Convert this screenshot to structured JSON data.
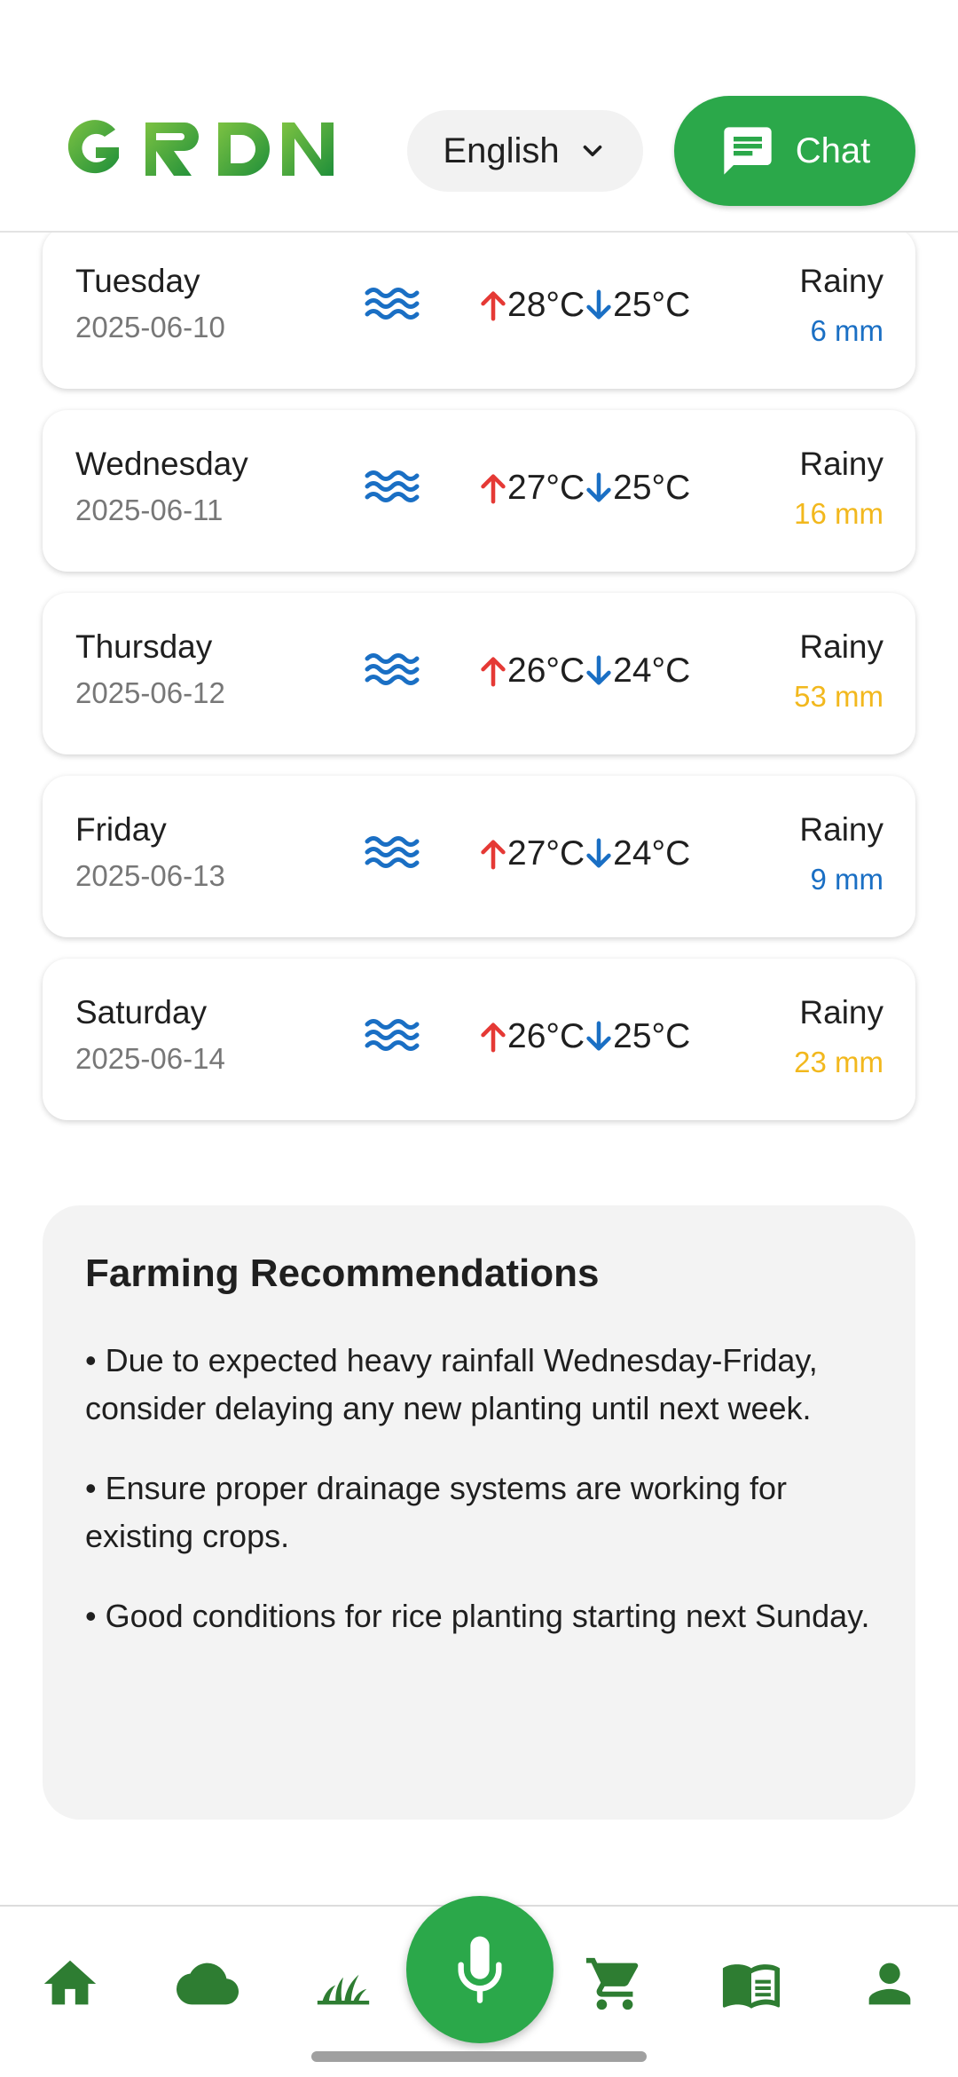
{
  "header": {
    "logo_text": "GRDN",
    "language": "English",
    "chat_label": "Chat"
  },
  "forecast": [
    {
      "day": "Tuesday",
      "date": "2025-06-10",
      "icon": "waves-icon",
      "high": "28°C",
      "low": "25°C",
      "condition": "Rainy",
      "rain": "6 mm",
      "rain_color": "#1a6fc4"
    },
    {
      "day": "Wednesday",
      "date": "2025-06-11",
      "icon": "waves-icon",
      "high": "27°C",
      "low": "25°C",
      "condition": "Rainy",
      "rain": "16 mm",
      "rain_color": "#f2b81d"
    },
    {
      "day": "Thursday",
      "date": "2025-06-12",
      "icon": "waves-icon",
      "high": "26°C",
      "low": "24°C",
      "condition": "Rainy",
      "rain": "53 mm",
      "rain_color": "#f2b81d"
    },
    {
      "day": "Friday",
      "date": "2025-06-13",
      "icon": "waves-icon",
      "high": "27°C",
      "low": "24°C",
      "condition": "Rainy",
      "rain": "9 mm",
      "rain_color": "#1a6fc4"
    },
    {
      "day": "Saturday",
      "date": "2025-06-14",
      "icon": "waves-icon",
      "high": "26°C",
      "low": "25°C",
      "condition": "Rainy",
      "rain": "23 mm",
      "rain_color": "#f2b81d"
    }
  ],
  "recommendations": {
    "title": "Farming Recommendations",
    "items": [
      "• Due to expected heavy rainfall Wednesday-Friday, consider delaying any new planting until next week.",
      "• Ensure proper drainage systems are working for existing crops.",
      "• Good conditions for rice planting starting next Sunday."
    ]
  },
  "bottom_nav": [
    "home-icon",
    "cloud-icon",
    "plant-icon",
    "microphone-icon",
    "cart-icon",
    "book-icon",
    "person-icon"
  ],
  "colors": {
    "brand_green": "#2ba84a",
    "nav_green": "#2e7d32",
    "temp_up": "#e53935",
    "temp_down": "#1a6fc4",
    "wave_blue": "#1a6fc4"
  }
}
